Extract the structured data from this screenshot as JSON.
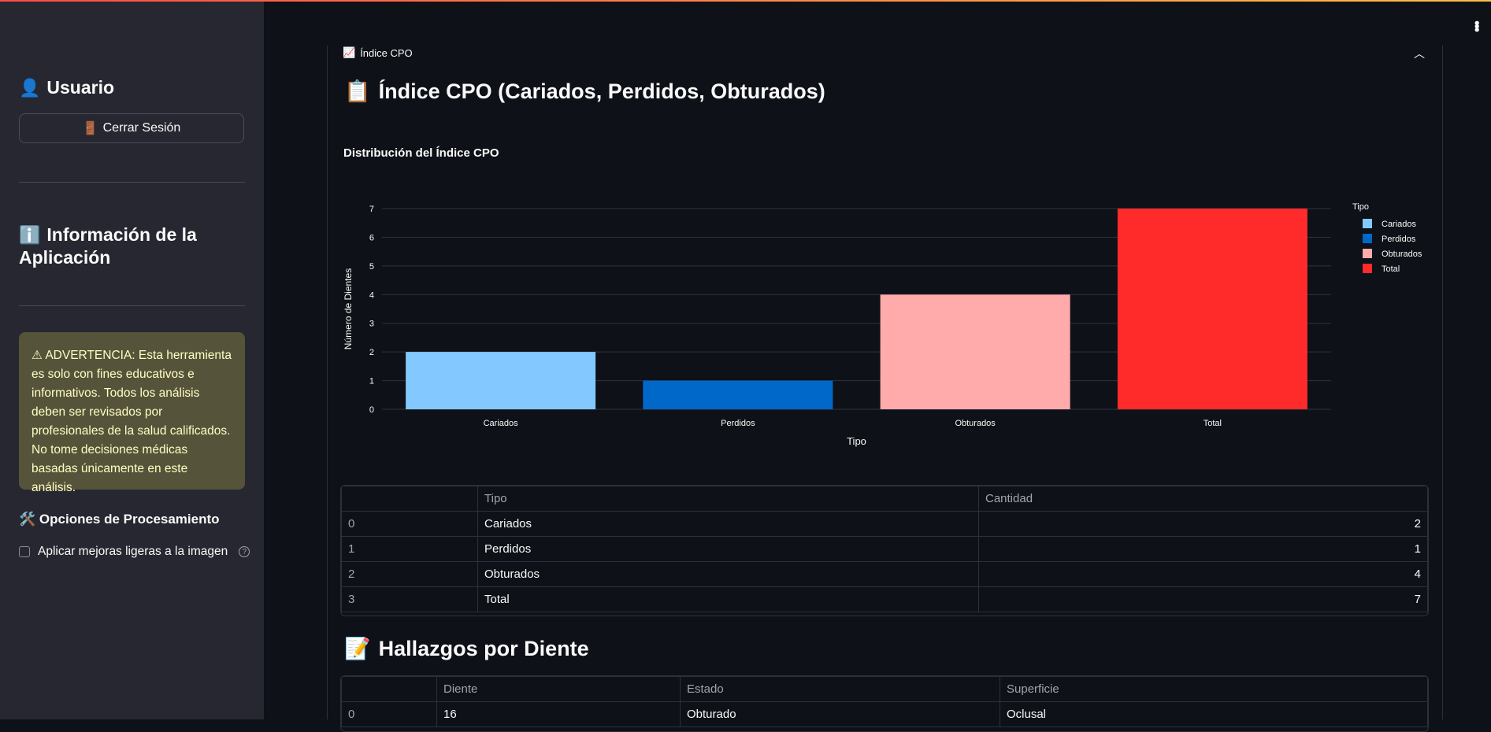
{
  "sidebar": {
    "user_heading": "Usuario",
    "user_icon": "bust-in-silhouette-icon",
    "logout_label": "Cerrar Sesión",
    "info_heading": "Información de la Aplicación",
    "warning_text": "⚠ ADVERTENCIA: Esta herramienta es solo con fines educativos e informativos. Todos los análisis deben ser revisados por profesionales de la salud calificados. No tome decisiones médicas basadas únicamente en este análisis.",
    "processing_heading": "Opciones de Procesamiento",
    "enhance_checkbox_label": "Aplicar mejoras ligeras a la imagen",
    "enhance_checked": false
  },
  "main": {
    "expander_label": "Índice CPO",
    "cpo_heading": "Índice CPO (Cariados, Perdidos, Obturados)",
    "findings_heading": "Hallazgos por Diente"
  },
  "chart_data": {
    "type": "bar",
    "title": "Distribución del Índice CPO",
    "xlabel": "Tipo",
    "ylabel": "Número de Dientes",
    "categories": [
      "Cariados",
      "Perdidos",
      "Obturados",
      "Total"
    ],
    "values": [
      2,
      1,
      4,
      7
    ],
    "colors": [
      "#83c9ff",
      "#0068c9",
      "#ffabab",
      "#ff2b2b"
    ],
    "ylim": [
      0,
      7
    ],
    "yticks": [
      "0",
      "1",
      "2",
      "3",
      "4",
      "5",
      "6",
      "7"
    ],
    "grid": true,
    "legend_title": "Tipo",
    "legend_position": "right"
  },
  "cpo_table": {
    "columns": [
      "",
      "Tipo",
      "Cantidad"
    ],
    "rows": [
      [
        "0",
        "Cariados",
        "2"
      ],
      [
        "1",
        "Perdidos",
        "1"
      ],
      [
        "2",
        "Obturados",
        "4"
      ],
      [
        "3",
        "Total",
        "7"
      ]
    ]
  },
  "findings_table": {
    "columns": [
      "",
      "Diente",
      "Estado",
      "Superficie"
    ],
    "rows": [
      [
        "0",
        "16",
        "Obturado",
        "Oclusal"
      ]
    ]
  },
  "colors": {
    "sidebar_bg": "#262730",
    "main_bg": "#0e1117",
    "warning_bg": "#56533b",
    "warning_text": "#ffffc2"
  }
}
